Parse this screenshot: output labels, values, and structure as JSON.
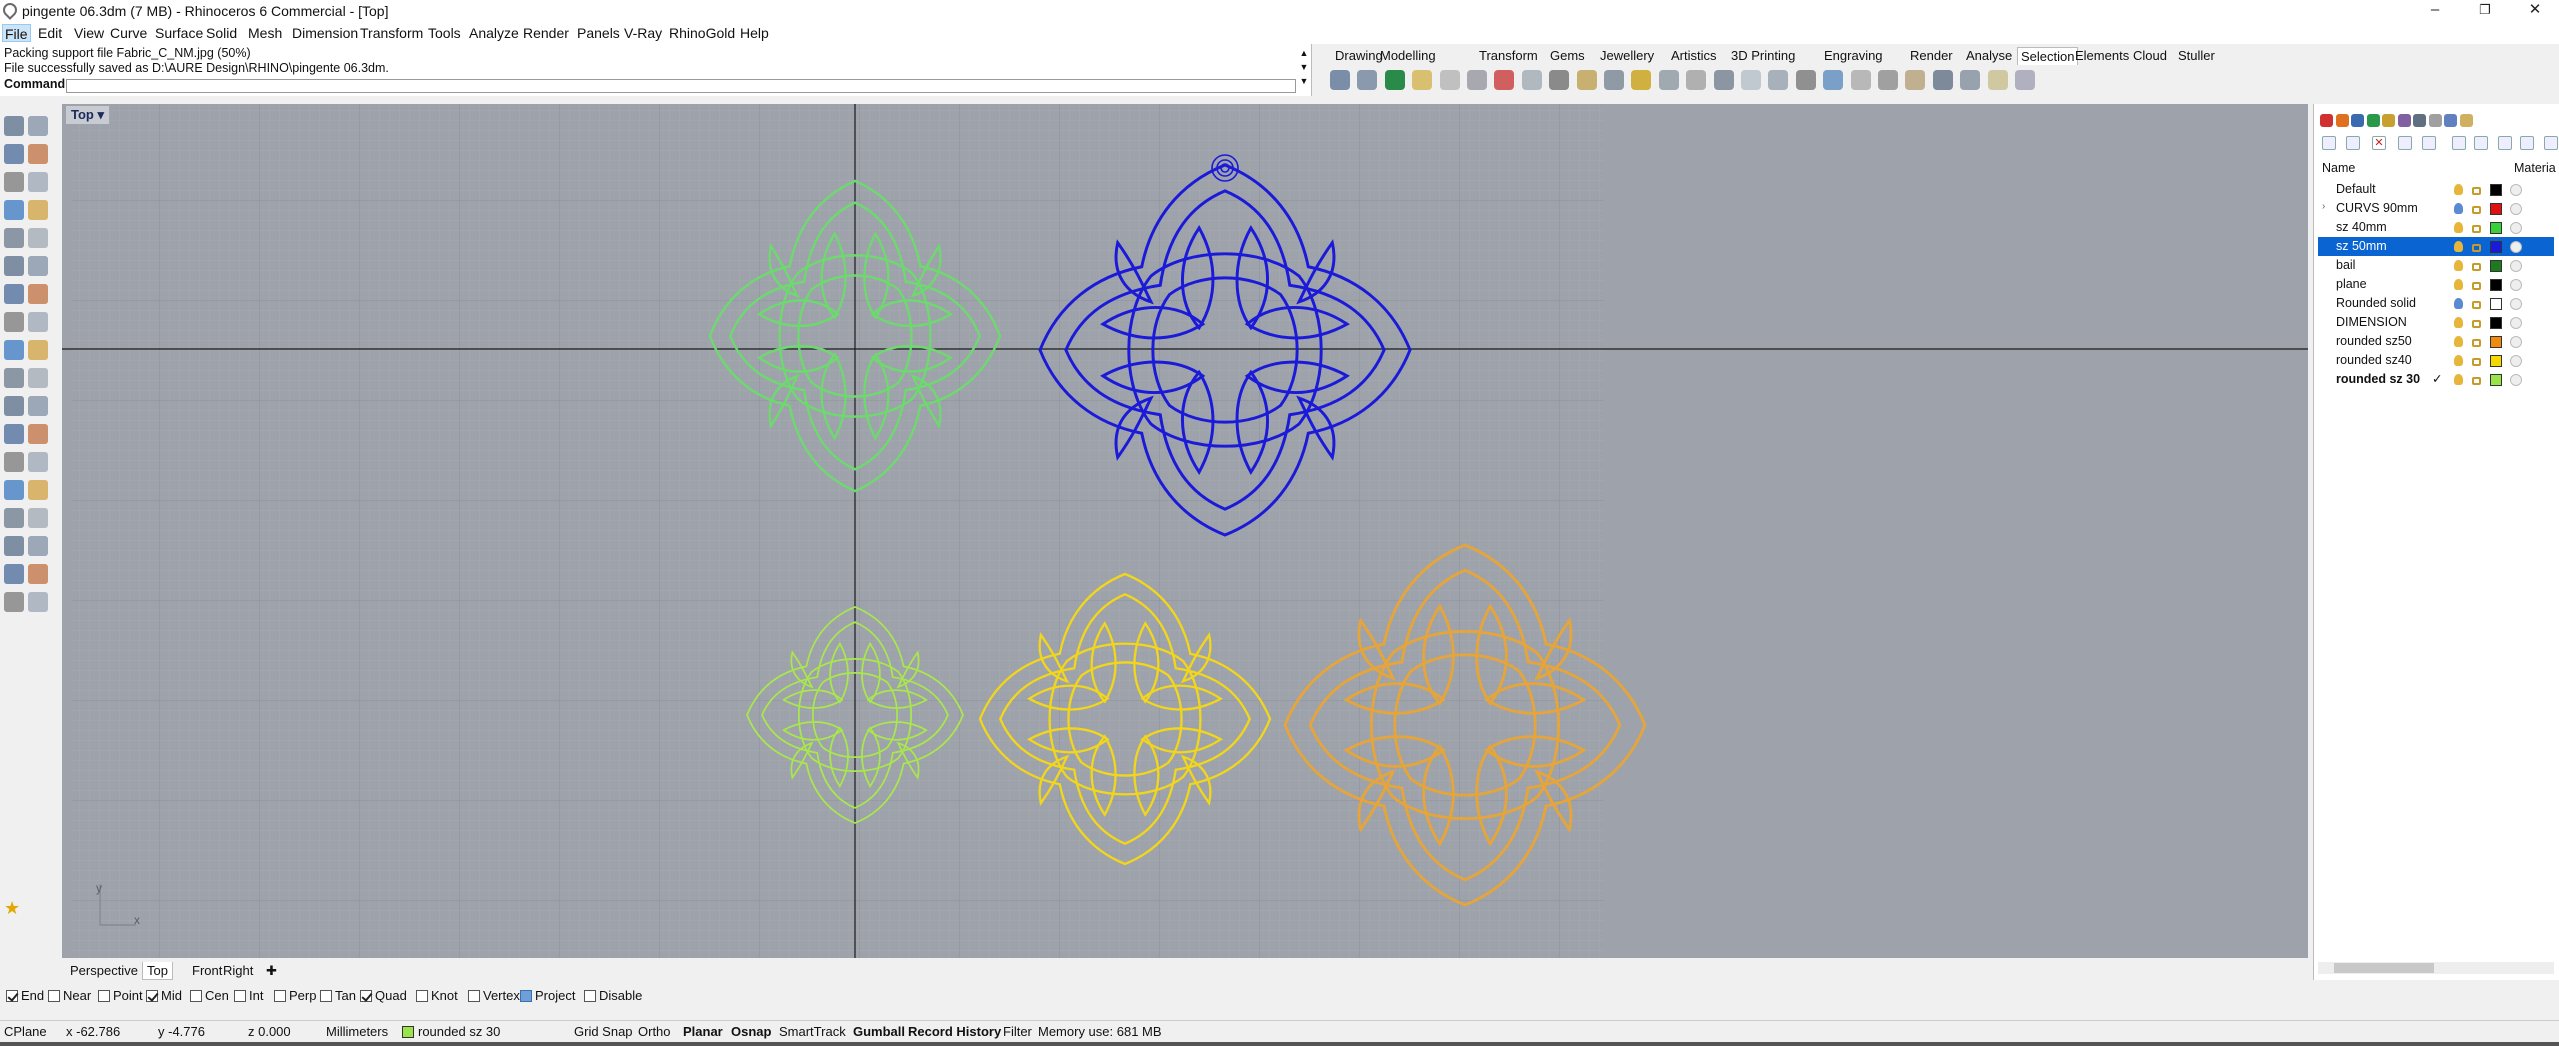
{
  "window": {
    "title": "pingente 06.3dm (7 MB) - Rhinoceros 6 Commercial - [Top]",
    "minimize": "–",
    "maximize": "❐",
    "close": "✕"
  },
  "menu": [
    "File",
    "Edit",
    "View",
    "Curve",
    "Surface",
    "Solid",
    "Mesh",
    "Dimension",
    "Transform",
    "Tools",
    "Analyze",
    "Render",
    "Panels",
    "V-Ray",
    "RhinoGold",
    "Help"
  ],
  "command_history": [
    "Packing support file Fabric_C_NM.jpg (50%)",
    "File successfully saved as D:\\AURE Design\\RHINO\\pingente 06.3dm."
  ],
  "command": {
    "label": "Command:",
    "value": ""
  },
  "toolbar_tabs": [
    "Drawing",
    "Modelling",
    "Transform",
    "Gems",
    "Jewellery",
    "Artistics",
    "3D Printing",
    "Engraving",
    "Render",
    "Analyse",
    "Selection",
    "Elements",
    "Cloud",
    "Stuller"
  ],
  "active_toolbar_tab": "Selection",
  "viewport": {
    "name": "Top",
    "axis_x": "x",
    "axis_y": "y"
  },
  "viewport_tabs": [
    "Perspective",
    "Top",
    "Front",
    "Right"
  ],
  "active_viewport_tab": "Top",
  "osnaps": [
    {
      "label": "End",
      "checked": true
    },
    {
      "label": "Near",
      "checked": false
    },
    {
      "label": "Point",
      "checked": false
    },
    {
      "label": "Mid",
      "checked": true
    },
    {
      "label": "Cen",
      "checked": false
    },
    {
      "label": "Int",
      "checked": false
    },
    {
      "label": "Perp",
      "checked": false
    },
    {
      "label": "Tan",
      "checked": false
    },
    {
      "label": "Quad",
      "checked": true
    },
    {
      "label": "Knot",
      "checked": false
    },
    {
      "label": "Vertex",
      "checked": false
    },
    {
      "label": "Project",
      "checked": true
    },
    {
      "label": "Disable",
      "checked": false
    }
  ],
  "status": {
    "cplane": "CPlane",
    "x": "x -62.786",
    "y": "y -4.776",
    "z": "z 0.000",
    "units": "Millimeters",
    "current_layer": "rounded sz 30",
    "current_layer_color": "#9be34a",
    "grid_snap": "Grid Snap",
    "ortho": "Ortho",
    "planar": "Planar",
    "osnap": "Osnap",
    "smarttrack": "SmartTrack",
    "gumball": "Gumball",
    "record_history": "Record History",
    "filter": "Filter",
    "memory": "Memory use: 681 MB"
  },
  "layers": {
    "header_name": "Name",
    "header_material": "Materia",
    "rows": [
      {
        "name": "Default",
        "color": "#000000",
        "selected": false,
        "current": false,
        "expandable": false
      },
      {
        "name": "CURVS 90mm",
        "color": "#e01010",
        "selected": false,
        "current": false,
        "expandable": true
      },
      {
        "name": "sz 40mm",
        "color": "#3ad03a",
        "selected": false,
        "current": false,
        "expandable": false
      },
      {
        "name": "sz 50mm",
        "color": "#1a1ad8",
        "selected": true,
        "current": false,
        "expandable": false
      },
      {
        "name": "bail",
        "color": "#1e7a1e",
        "selected": false,
        "current": false,
        "expandable": false
      },
      {
        "name": "plane",
        "color": "#000000",
        "selected": false,
        "current": false,
        "expandable": false
      },
      {
        "name": "Rounded solid",
        "color": "#ffffff",
        "selected": false,
        "current": false,
        "expandable": false
      },
      {
        "name": "DIMENSION",
        "color": "#000000",
        "selected": false,
        "current": false,
        "expandable": false
      },
      {
        "name": "rounded sz50",
        "color": "#f08a10",
        "selected": false,
        "current": false,
        "expandable": false
      },
      {
        "name": "rounded sz40",
        "color": "#f5d800",
        "selected": false,
        "current": false,
        "expandable": false
      },
      {
        "name": "rounded sz 30",
        "color": "#9be34a",
        "selected": false,
        "current": true,
        "expandable": false
      }
    ]
  },
  "current_mark": "✓",
  "colors": {
    "viewport_bg": "#9ea3ab",
    "selection_blue": "#0a64d2",
    "shape_green": "#6ed96e",
    "shape_blue": "#1a1ad8",
    "shape_lime": "#a8e84a",
    "shape_yellow": "#f2d61a",
    "shape_orange": "#e5a53a"
  }
}
